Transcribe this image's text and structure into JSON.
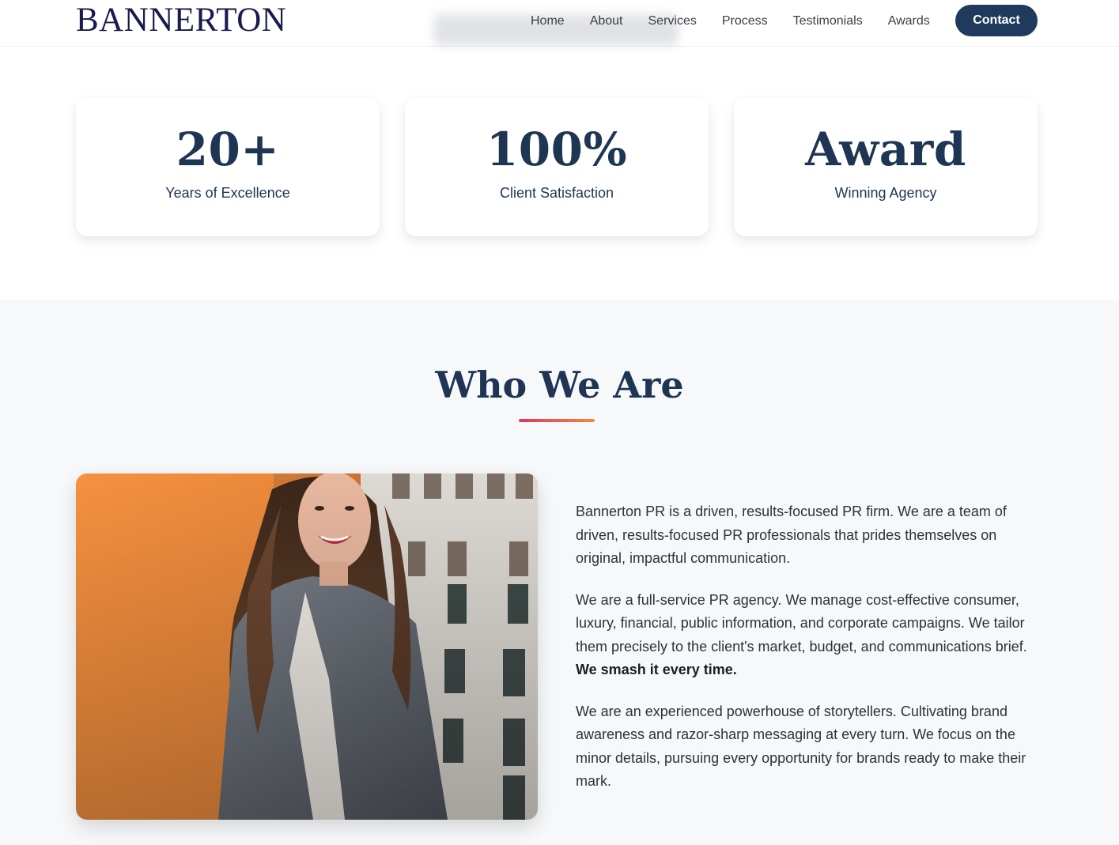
{
  "header": {
    "logo": "BANNERTON",
    "nav": [
      "Home",
      "About",
      "Services",
      "Process",
      "Testimonials",
      "Awards"
    ],
    "contact_label": "Contact"
  },
  "stats": [
    {
      "value": "20+",
      "label": "Years of Excellence"
    },
    {
      "value": "100%",
      "label": "Client Satisfaction"
    },
    {
      "value": "Award",
      "label": "Winning Agency"
    }
  ],
  "about": {
    "title": "Who We Are",
    "paragraph1": "Bannerton PR is a driven, results-focused PR firm. We are a team of driven, results-focused PR professionals that prides themselves on original, impactful communication.",
    "paragraph2": "We are a full-service PR agency. We manage cost-effective consumer, luxury, financial, public information, and corporate campaigns. We tailor them precisely to the client's market, budget, and communications brief.",
    "paragraph2_bold": "We smash it every time.",
    "paragraph3": "We are an experienced powerhouse of storytellers. Cultivating brand awareness and razor-sharp messaging at every turn. We focus on the minor details, pursuing every opportunity for brands ready to make their mark."
  },
  "colors": {
    "brand_navy": "#1e3553",
    "logo_navy": "#1a1a4e",
    "accent_gradient_start": "#e3345e",
    "accent_gradient_end": "#f08a3c"
  }
}
